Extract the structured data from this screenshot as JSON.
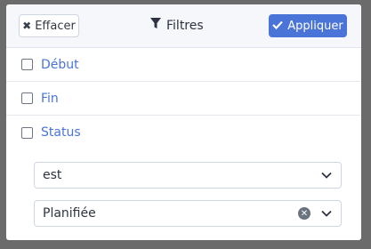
{
  "header": {
    "clear_label": "Effacer",
    "title": "Filtres",
    "apply_label": "Appliquer"
  },
  "filters": [
    {
      "label": "Début",
      "checked": false
    },
    {
      "label": "Fin",
      "checked": false
    },
    {
      "label": "Status",
      "checked": false
    }
  ],
  "status_filter": {
    "operator": "est",
    "value": "Planifiée"
  },
  "colors": {
    "accent": "#4a74d8",
    "header_bg": "#f5f7fb",
    "backdrop": "#6b6b6b"
  }
}
